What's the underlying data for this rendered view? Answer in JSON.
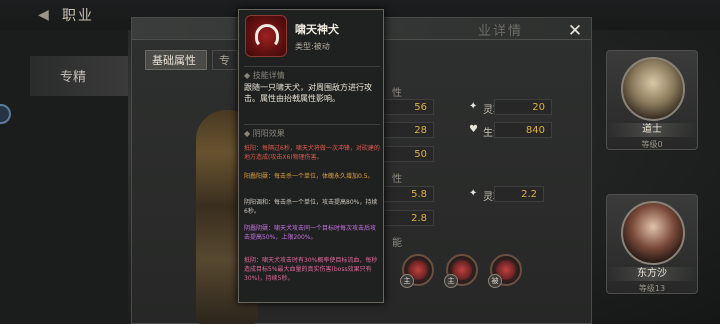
{
  "header": {
    "title": "职业"
  },
  "nav": {
    "active_label": "专精"
  },
  "panel": {
    "ghost_title": "业详情",
    "tabs": [
      "基础属性",
      "专"
    ],
    "stat_rows": [
      {
        "label": "",
        "value": "56",
        "right_label": "灵巧",
        "right_value": "20"
      },
      {
        "label": "",
        "value": "28",
        "right_label": "生命",
        "right_value": "840"
      },
      {
        "label": "",
        "value": "50"
      }
    ],
    "growth_rows": [
      {
        "label": "成长",
        "value": "5.8",
        "right_label": "灵巧成长",
        "right_value": "2.2"
      },
      {
        "label": "成长",
        "value": "2.8"
      }
    ],
    "section_marks": [
      "性",
      "性",
      "能"
    ],
    "skills": [
      {
        "badge": "主",
        "icon": "dragon-emblem-icon"
      },
      {
        "badge": "主",
        "icon": "claw-emblem-icon"
      },
      {
        "badge": "被",
        "icon": "wolf-emblem-icon"
      }
    ]
  },
  "characters": [
    {
      "name": "道士",
      "level": "等级0",
      "portrait": "elder-portrait"
    },
    {
      "name": "东方沙",
      "level": "等级13",
      "portrait": "girl-portrait"
    }
  ],
  "tooltip": {
    "title": "啸天神犬",
    "type": "类型:被动",
    "section_detail": "◆ 技能详情",
    "desc": "跟随一只啸天犬，对周围敌方进行攻击。属性由抬戟属性影响。",
    "section_effect": "◆ 阴阳效果",
    "effects": [
      {
        "color": "red",
        "text": "抵阳：每隔过6秒，啸天犬将做一次冲锋，对砍建的地方造成(攻击X6)物理伤害。"
      },
      {
        "color": "orange",
        "text": "阳蠢阳蘖：每击杀一个单位，体魄永久增加0.5。"
      },
      {
        "color": "white",
        "text": "阴阳调和：每击杀一个单位，攻击提高80%，持续6秒。"
      },
      {
        "color": "purple",
        "text": "阴蠢阴蘖：啸天犬攻击同一个目标时每次攻击后攻击提高50%，上限200%。"
      },
      {
        "color": "pink",
        "text": "抵阴：啸天犬攻击时有30%概率使目标流血，每秒造成目标5%最大血量的真实伤害(boss效果只有30%)，持续5秒。"
      }
    ]
  },
  "colors": {
    "accent_gold": "#e0b040",
    "tooltip_red": "#e05a4a",
    "tooltip_purple": "#c874e6"
  }
}
